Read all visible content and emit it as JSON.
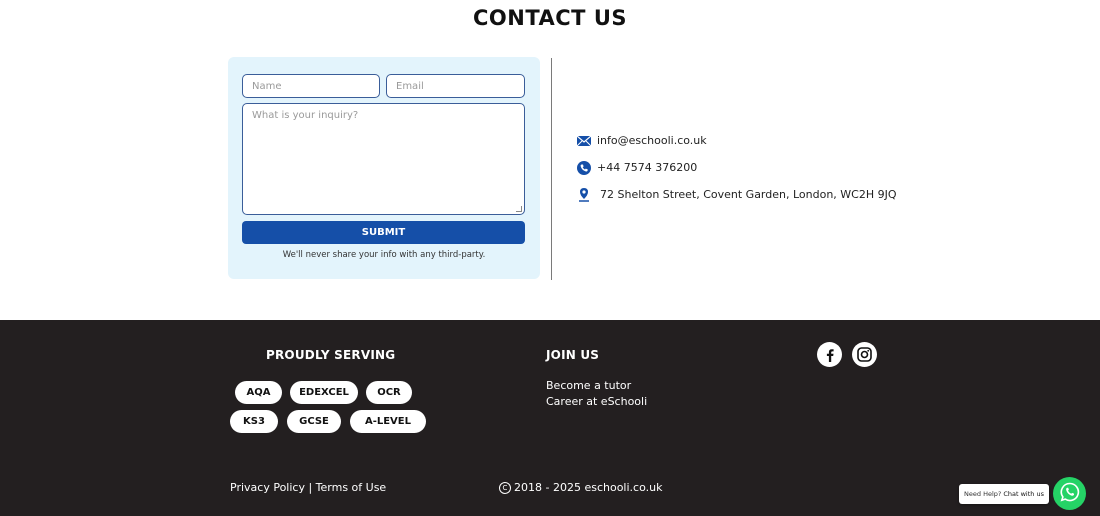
{
  "contact": {
    "title": "CONTACT US",
    "form": {
      "name_placeholder": "Name",
      "email_placeholder": "Email",
      "inquiry_placeholder": "What is your inquiry?",
      "submit_label": "SUBMIT",
      "privacy_note": "We'll never share your info with any third-party."
    },
    "info": {
      "email": "info@eschooli.co.uk",
      "phone": "+44 7574 376200",
      "address": "72 Shelton Street, Covent Garden, London, WC2H 9JQ"
    },
    "icon_color": "#154fa8"
  },
  "footer": {
    "background": "#231f20",
    "serving_heading": "PROUDLY SERVING",
    "boards": [
      "AQA",
      "EDEXCEL",
      "OCR",
      "KS3",
      "GCSE",
      "A-LEVEL"
    ],
    "join_heading": "JOIN US",
    "join_links": [
      "Become a tutor",
      "Career at eSchooli"
    ],
    "social_icons": [
      "facebook-icon",
      "instagram-icon"
    ],
    "legal_links": "Privacy Policy | Terms of Use",
    "copyright": "2018 - 2025 eschooli.co.uk"
  },
  "chat": {
    "prompt": "Need Help?",
    "action": "Chat with us",
    "button_color": "#25d366"
  }
}
